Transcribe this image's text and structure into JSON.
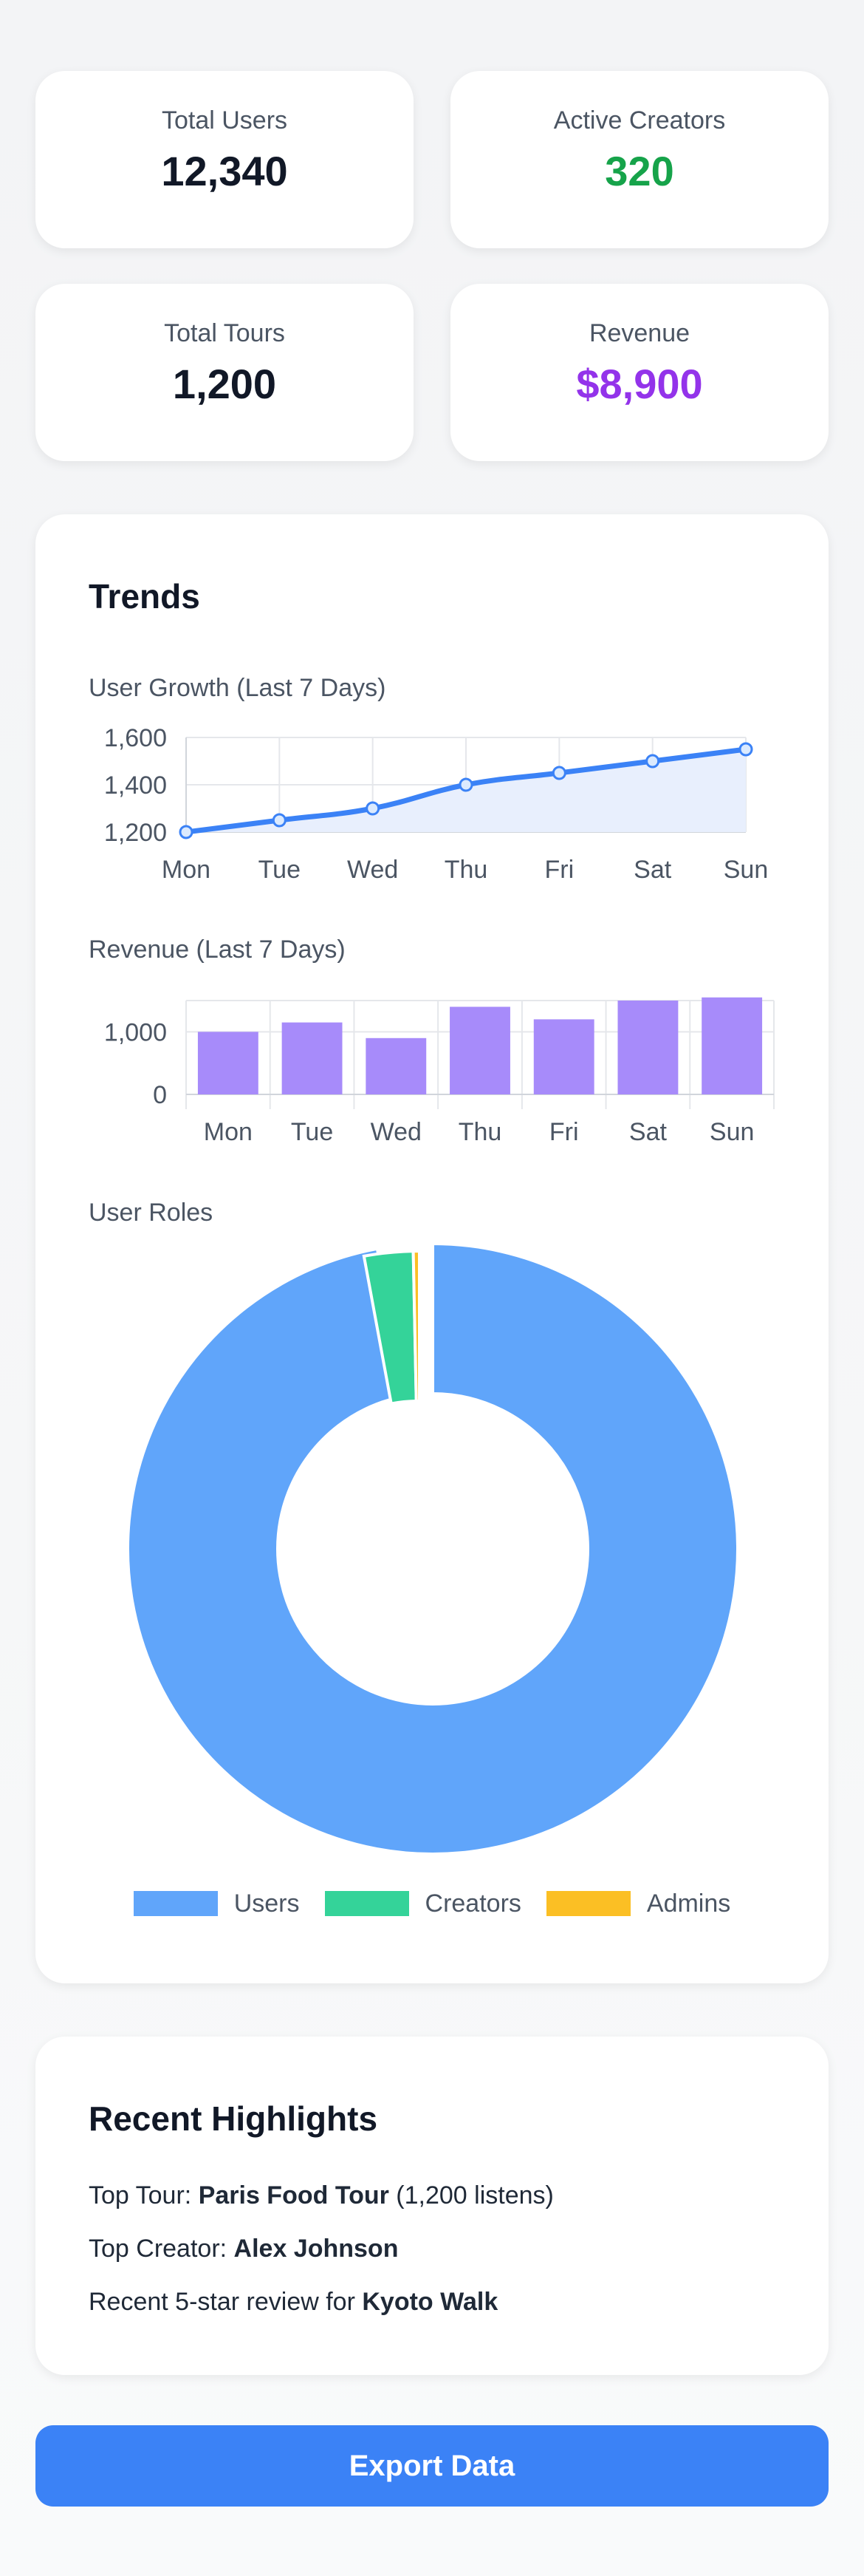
{
  "stats": [
    {
      "label": "Total Users",
      "value": "12,340",
      "color": "#111827"
    },
    {
      "label": "Active Creators",
      "value": "320",
      "color": "#16a34a"
    },
    {
      "label": "Total Tours",
      "value": "1,200",
      "color": "#111827"
    },
    {
      "label": "Revenue",
      "value": "$8,900",
      "color": "#9333ea"
    }
  ],
  "trends": {
    "title": "Trends",
    "user_growth_label": "User Growth (Last 7 Days)",
    "revenue_label": "Revenue (Last 7 Days)",
    "roles_label": "User Roles"
  },
  "chart_data": [
    {
      "type": "line",
      "title": "User Growth (Last 7 Days)",
      "categories": [
        "Mon",
        "Tue",
        "Wed",
        "Thu",
        "Fri",
        "Sat",
        "Sun"
      ],
      "values": [
        1200,
        1250,
        1300,
        1400,
        1450,
        1500,
        1550
      ],
      "ylim": [
        1200,
        1600
      ],
      "yticks": [
        "1,200",
        "1,400",
        "1,600"
      ],
      "color": "#3b82f6",
      "fill": "#e8effd",
      "grid": true
    },
    {
      "type": "bar",
      "title": "Revenue (Last 7 Days)",
      "categories": [
        "Mon",
        "Tue",
        "Wed",
        "Thu",
        "Fri",
        "Sat",
        "Sun"
      ],
      "values": [
        1000,
        1150,
        900,
        1400,
        1200,
        1500,
        1550
      ],
      "ylim": [
        0,
        1500
      ],
      "yticks": [
        "0",
        "1,000"
      ],
      "color": "#a78bfa",
      "grid": true
    },
    {
      "type": "pie",
      "title": "User Roles",
      "donut": true,
      "categories": [
        "Users",
        "Creators",
        "Admins"
      ],
      "values": [
        12000,
        320,
        40
      ],
      "colors": [
        "#60a5fa",
        "#34d399",
        "#fbbf24"
      ],
      "legend": "bottom"
    }
  ],
  "highlights": {
    "title": "Recent Highlights",
    "top_tour_prefix": "Top Tour: ",
    "top_tour_name": "Paris Food Tour",
    "top_tour_suffix": " (1,200 listens)",
    "top_creator_prefix": "Top Creator: ",
    "top_creator_name": "Alex Johnson",
    "review_prefix": "Recent 5-star review for ",
    "review_name": "Kyoto Walk"
  },
  "export_label": "Export Data"
}
